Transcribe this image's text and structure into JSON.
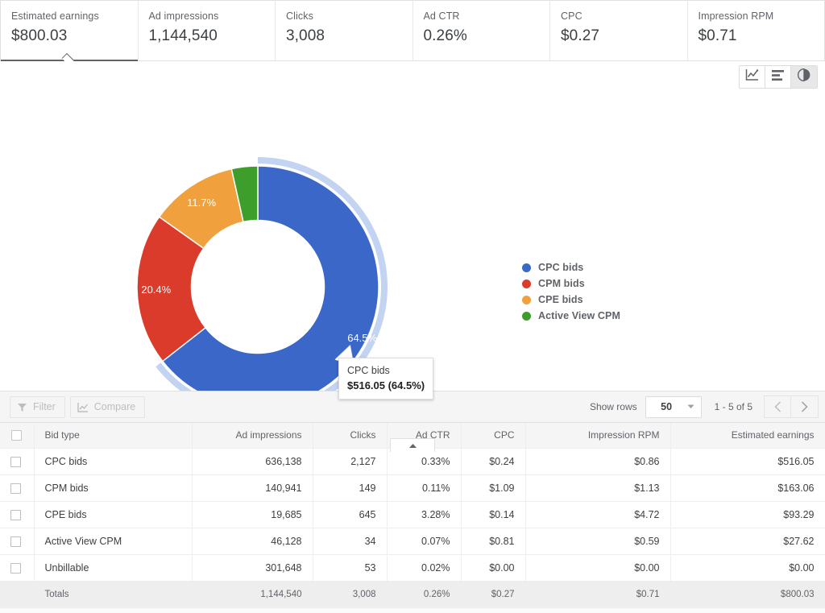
{
  "metrics": [
    {
      "label": "Estimated earnings",
      "value": "$800.03",
      "selected": true
    },
    {
      "label": "Ad impressions",
      "value": "1,144,540",
      "selected": false
    },
    {
      "label": "Clicks",
      "value": "3,008",
      "selected": false
    },
    {
      "label": "Ad CTR",
      "value": "0.26%",
      "selected": false
    },
    {
      "label": "CPC",
      "value": "$0.27",
      "selected": false
    },
    {
      "label": "Impression RPM",
      "value": "$0.71",
      "selected": false
    }
  ],
  "chart_toggles": [
    {
      "icon": "line-chart-icon",
      "active": false
    },
    {
      "icon": "bar-chart-icon",
      "active": false
    },
    {
      "icon": "pie-chart-icon",
      "active": true
    }
  ],
  "tooltip": {
    "title": "CPC bids",
    "value": "$516.05 (64.5%)"
  },
  "legend": {
    "position": "right",
    "items": [
      {
        "label": "CPC bids",
        "color": "#3a67c8"
      },
      {
        "label": "CPM bids",
        "color": "#db3b2b"
      },
      {
        "label": "CPE bids",
        "color": "#f0a03c"
      },
      {
        "label": "Active View CPM",
        "color": "#3e9e2c"
      }
    ]
  },
  "chart_data": {
    "type": "pie",
    "variant": "donut",
    "title": "",
    "metric": "Estimated earnings",
    "categories": [
      "CPC bids",
      "CPM bids",
      "CPE bids",
      "Active View CPM"
    ],
    "values": [
      516.05,
      163.06,
      93.29,
      27.62
    ],
    "percentages": [
      64.5,
      20.4,
      11.7,
      3.5
    ],
    "labels": [
      "64.5%",
      "20.4%",
      "11.7%",
      ""
    ],
    "colors": [
      "#3a67c8",
      "#db3b2b",
      "#f0a03c",
      "#3e9e2c"
    ],
    "highlight_color": "#c3d3f2",
    "highlighted_slice": "CPC bids",
    "start_angle": 0,
    "direction": "clockwise",
    "inner_radius_ratio": 0.55,
    "legend": "right",
    "grid": false
  },
  "collapse_handle": {
    "icon": "caret-up-icon"
  },
  "toolbar": {
    "filter_label": "Filter",
    "compare_label": "Compare",
    "show_rows_label": "Show rows",
    "rows_value": "50",
    "range_label": "1 - 5 of 5",
    "prev_icon": "chevron-left-icon",
    "next_icon": "chevron-right-icon"
  },
  "table": {
    "columns": [
      "Bid type",
      "Ad impressions",
      "Clicks",
      "Ad CTR",
      "CPC",
      "Impression RPM",
      "Estimated earnings"
    ],
    "rows": [
      {
        "name": "CPC bids",
        "impressions": "636,138",
        "clicks": "2,127",
        "ctr": "0.33%",
        "cpc": "$0.24",
        "rpm": "$0.86",
        "earnings": "$516.05"
      },
      {
        "name": "CPM bids",
        "impressions": "140,941",
        "clicks": "149",
        "ctr": "0.11%",
        "cpc": "$1.09",
        "rpm": "$1.13",
        "earnings": "$163.06"
      },
      {
        "name": "CPE bids",
        "impressions": "19,685",
        "clicks": "645",
        "ctr": "3.28%",
        "cpc": "$0.14",
        "rpm": "$4.72",
        "earnings": "$93.29"
      },
      {
        "name": "Active View CPM",
        "impressions": "46,128",
        "clicks": "34",
        "ctr": "0.07%",
        "cpc": "$0.81",
        "rpm": "$0.59",
        "earnings": "$27.62"
      },
      {
        "name": "Unbillable",
        "impressions": "301,648",
        "clicks": "53",
        "ctr": "0.02%",
        "cpc": "$0.00",
        "rpm": "$0.00",
        "earnings": "$0.00"
      }
    ],
    "totals": {
      "name": "Totals",
      "impressions": "1,144,540",
      "clicks": "3,008",
      "ctr": "0.26%",
      "cpc": "$0.27",
      "rpm": "$0.71",
      "earnings": "$800.03"
    }
  }
}
